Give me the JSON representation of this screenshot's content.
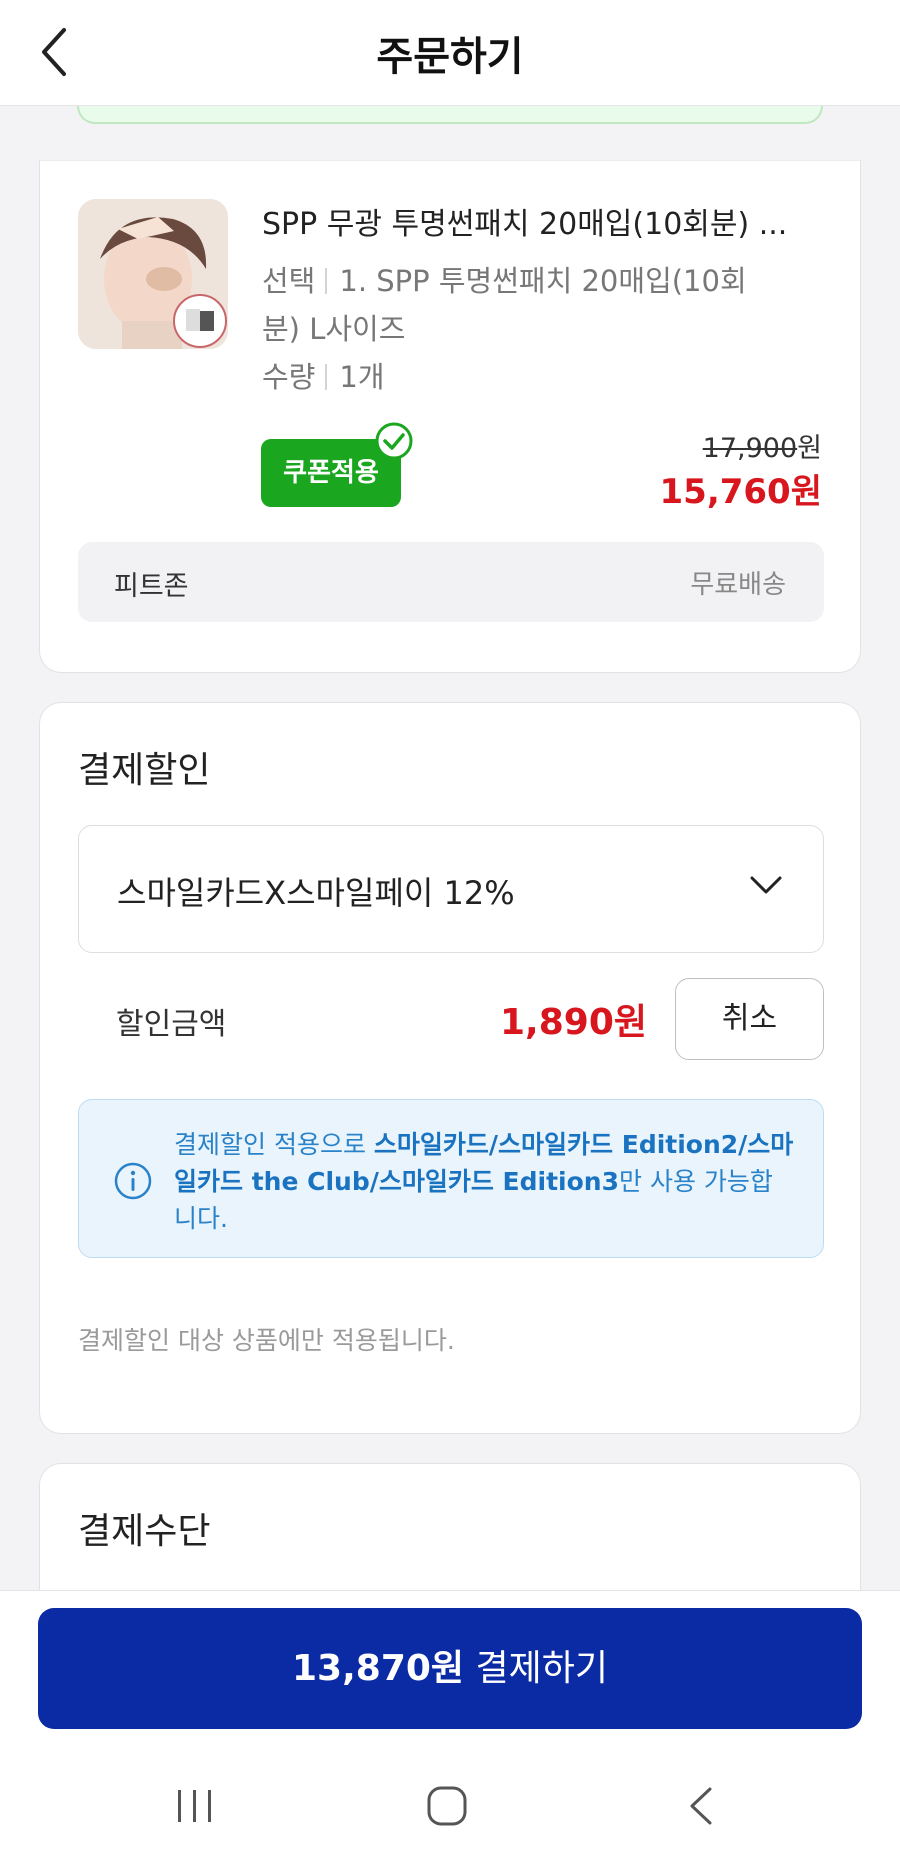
{
  "header": {
    "title": "주문하기"
  },
  "product": {
    "name": "SPP 무광 투명썬패치 20매입(10회분) ...",
    "option_label": "선택",
    "option_value_line1": "1. SPP 투명썬패치 20매입(10회",
    "option_value_line2": "분) L사이즈",
    "quantity_label": "수량",
    "quantity_value": "1개",
    "coupon_badge": "쿠폰적용",
    "original_price": "17,900",
    "original_price_unit": "원",
    "final_price": "15,760원",
    "seller": "피트존",
    "shipping": "무료배송"
  },
  "payment_discount": {
    "title": "결제할인",
    "selected_option": "스마일카드X스마일페이 12%",
    "amount_label": "할인금액",
    "amount_value": "1,890원",
    "cancel_label": "취소",
    "info_prefix": "결제할인 적용으로 ",
    "info_highlight": "스마일카드/스마일카드 Edition2/스마일카드 the Club/스마일카드 Edition3",
    "info_suffix": "만 사용 가능합니다.",
    "note": "결제할인 대상 상품에만 적용됩니다."
  },
  "payment_method": {
    "title": "결제수단"
  },
  "pay_button": {
    "amount": "13,870원",
    "label": "결제하기"
  },
  "colors": {
    "brand_blue": "#0a2ba4",
    "price_red": "#d7161e",
    "coupon_green": "#1aa61f",
    "info_blue": "#2a82c9"
  },
  "icons": [
    "back-arrow-icon",
    "check-circle-icon",
    "chevron-down-icon",
    "info-icon",
    "recent-apps-icon",
    "home-icon",
    "system-back-icon"
  ]
}
